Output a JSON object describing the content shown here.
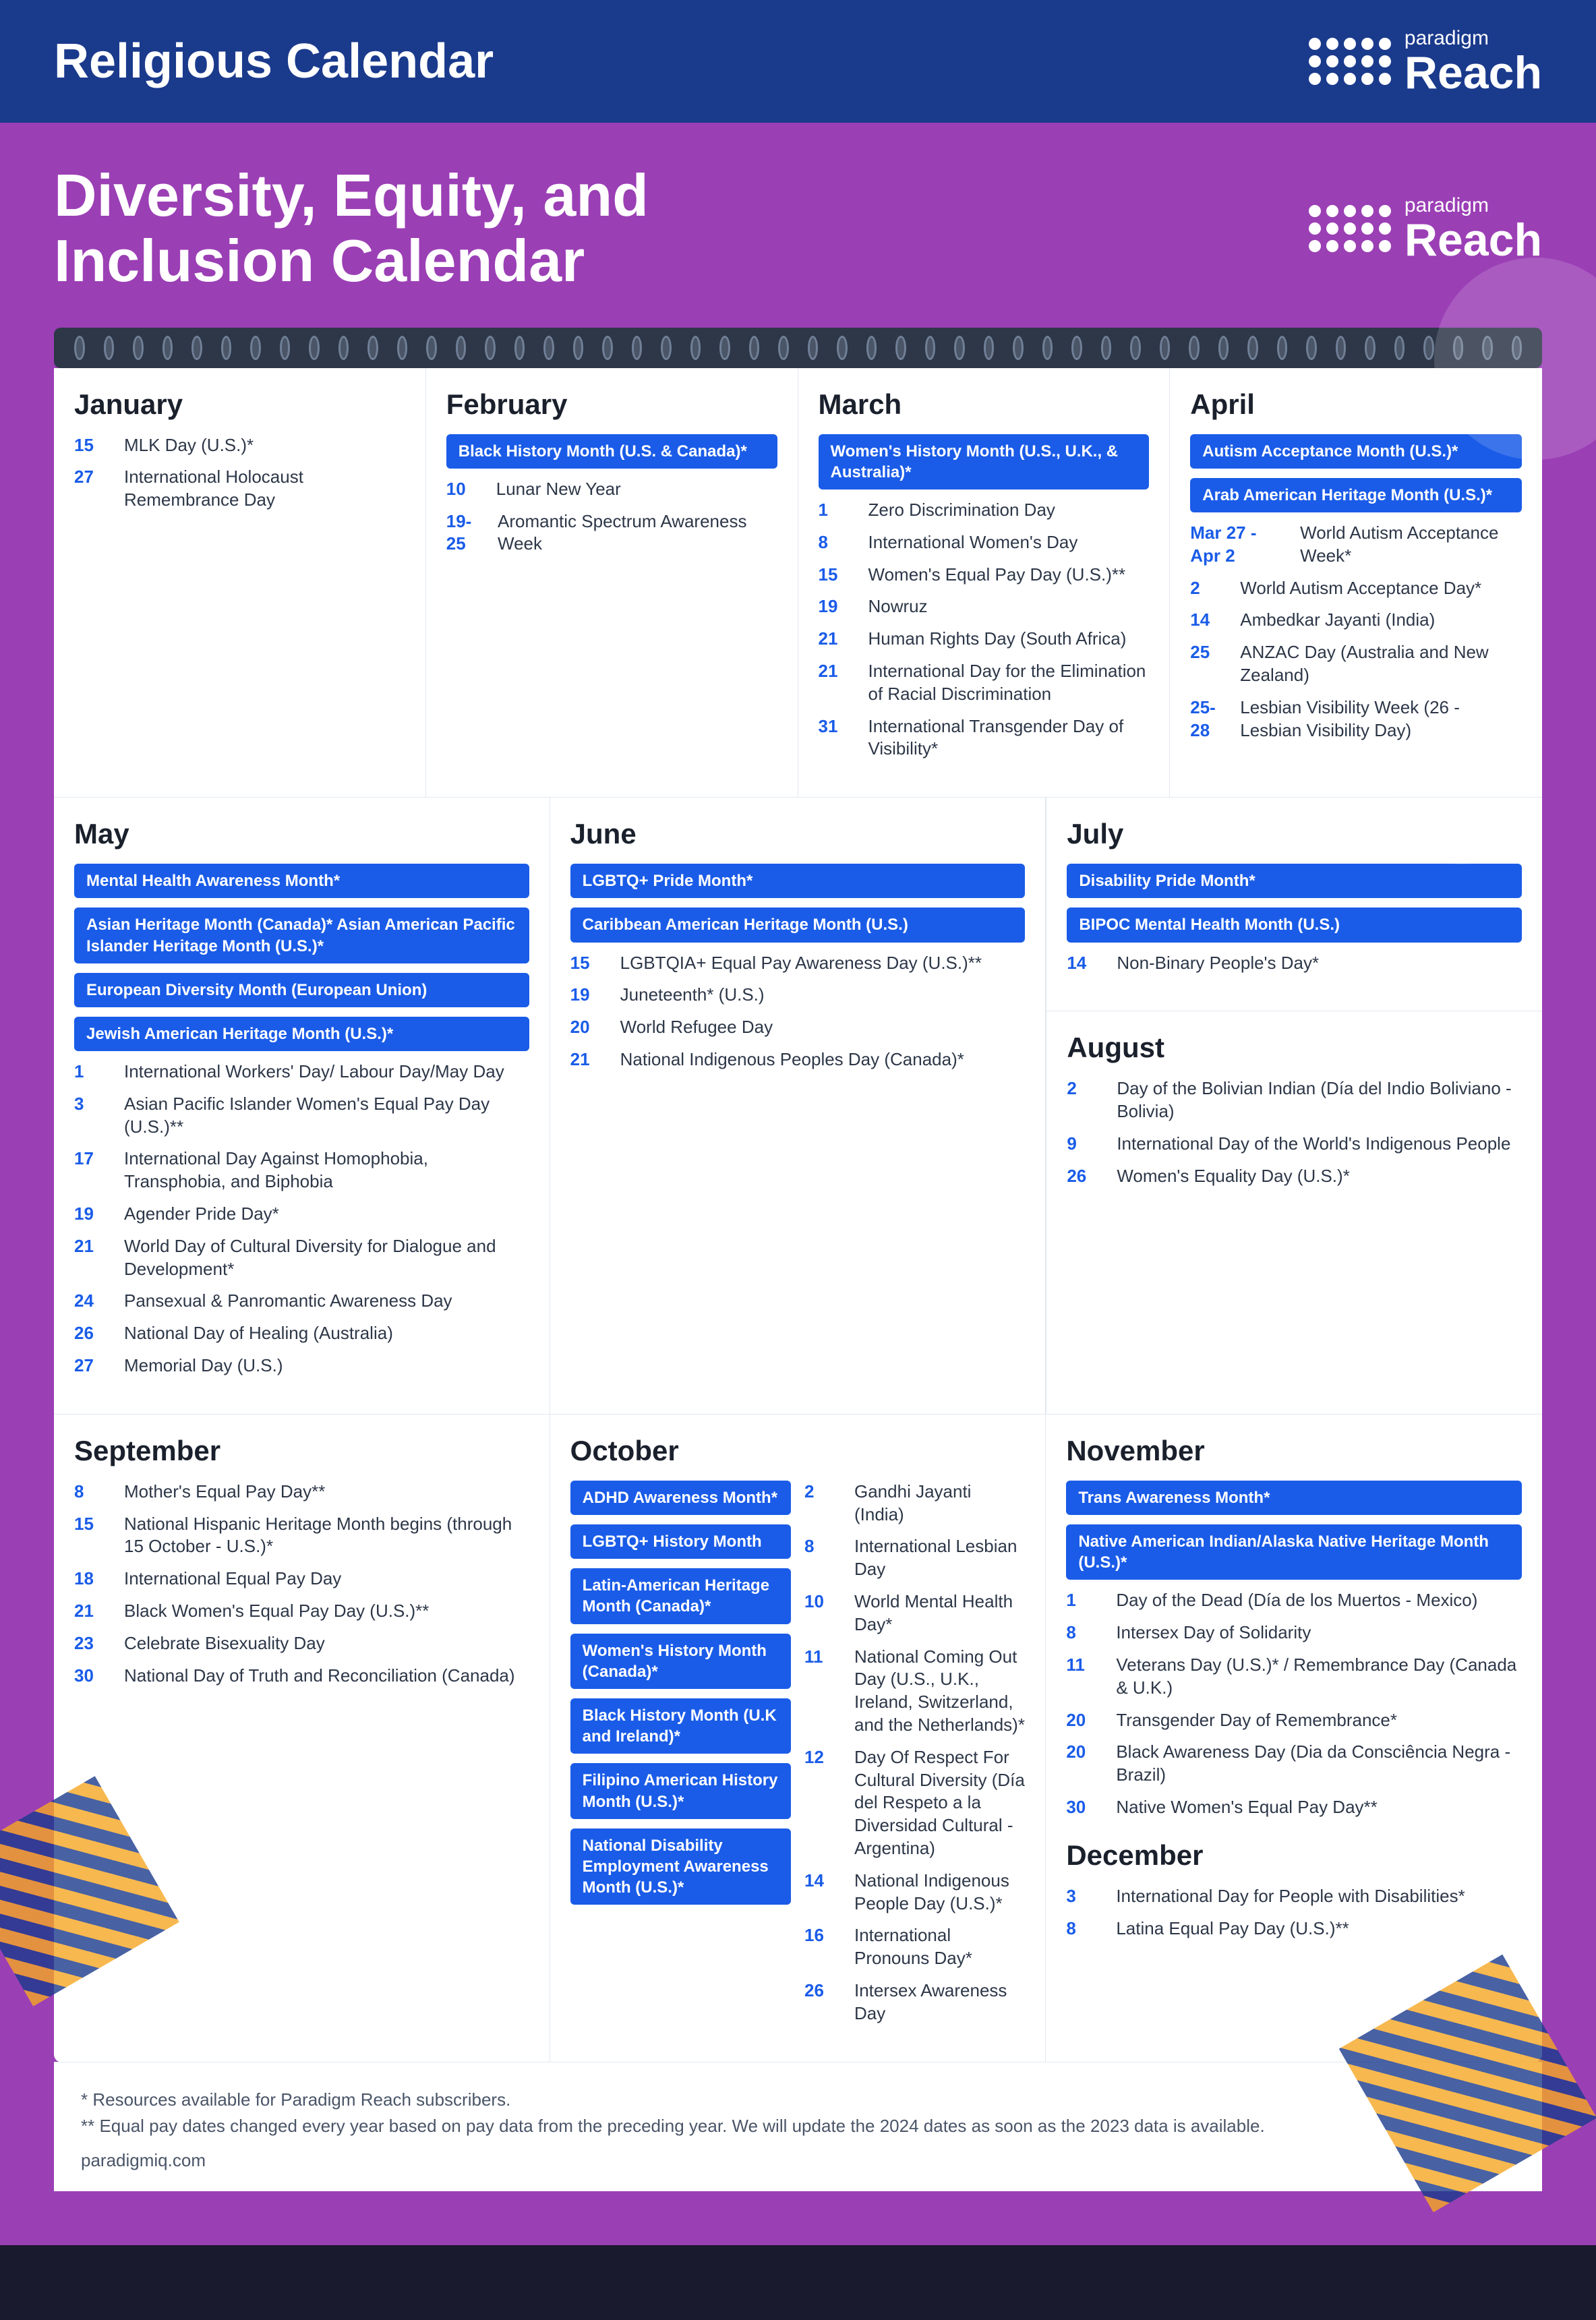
{
  "header": {
    "title": "Religious Calendar",
    "logo_paradigm": "paradigm",
    "logo_reach": "Reach"
  },
  "dei": {
    "title": "Diversity, Equity, and Inclusion Calendar",
    "logo_paradigm": "paradigm",
    "logo_reach": "Reach"
  },
  "months": {
    "january": {
      "name": "January",
      "badges": [],
      "events": [
        {
          "date": "15",
          "text": "MLK Day (U.S.)*"
        },
        {
          "date": "27",
          "text": "International Holocaust Remembrance Day"
        }
      ]
    },
    "february": {
      "name": "February",
      "badges": [
        {
          "text": "Black History Month (U.S. & Canada)*"
        }
      ],
      "events": [
        {
          "date": "10",
          "text": "Lunar New Year"
        },
        {
          "date": "19-25",
          "text": "Aromantic Spectrum Awareness Week"
        }
      ]
    },
    "march": {
      "name": "March",
      "badges": [
        {
          "text": "Women's History Month (U.S., U.K., & Australia)*"
        }
      ],
      "events": [
        {
          "date": "1",
          "text": "Zero Discrimination Day"
        },
        {
          "date": "8",
          "text": "International Women's Day"
        },
        {
          "date": "15",
          "text": "Women's Equal Pay Day (U.S.)**"
        },
        {
          "date": "19",
          "text": "Nowruz"
        },
        {
          "date": "21",
          "text": "Human Rights Day (South Africa)"
        },
        {
          "date": "21",
          "text": "International Day for the Elimination of Racial Discrimination"
        },
        {
          "date": "31",
          "text": "International Transgender Day of Visibility*"
        }
      ]
    },
    "april": {
      "name": "April",
      "badges": [
        {
          "text": "Autism Acceptance Month (U.S.)*"
        },
        {
          "text": "Arab American Heritage Month (U.S.)*"
        }
      ],
      "events": [
        {
          "date": "Mar 27 - Apr 2",
          "text": "World Autism Acceptance Week*"
        },
        {
          "date": "2",
          "text": "World Autism Acceptance Day*"
        },
        {
          "date": "14",
          "text": "Ambedkar Jayanti (India)"
        },
        {
          "date": "25",
          "text": "ANZAC Day (Australia and New Zealand)"
        },
        {
          "date": "25-28",
          "text": "Lesbian Visibility Week (26 - Lesbian Visibility Day)"
        }
      ]
    },
    "may": {
      "name": "May",
      "badges": [
        {
          "text": "Mental Health Awareness Month*"
        },
        {
          "text": "Asian Heritage Month (Canada)* Asian American Pacific Islander Heritage Month (U.S.)*"
        },
        {
          "text": "European Diversity Month (European Union)"
        },
        {
          "text": "Jewish American Heritage Month (U.S.)*"
        }
      ],
      "events": [
        {
          "date": "1",
          "text": "International Workers' Day/ Labour Day/May Day"
        },
        {
          "date": "3",
          "text": "Asian Pacific Islander Women's Equal Pay Day (U.S.)**"
        },
        {
          "date": "17",
          "text": "International Day Against Homophobia, Transphobia, and Biphobia"
        },
        {
          "date": "19",
          "text": "Agender Pride Day*"
        },
        {
          "date": "21",
          "text": "World Day of Cultural Diversity for Dialogue and Development*"
        },
        {
          "date": "24",
          "text": "Pansexual & Panromantic Awareness Day"
        },
        {
          "date": "26",
          "text": "National Day of Healing (Australia)"
        },
        {
          "date": "27",
          "text": "Memorial Day (U.S.)"
        }
      ]
    },
    "june": {
      "name": "June",
      "badges": [
        {
          "text": "LGBTQ+ Pride Month*"
        },
        {
          "text": "Caribbean American Heritage Month (U.S.)"
        }
      ],
      "events": [
        {
          "date": "15",
          "text": "LGBTQIA+ Equal Pay Awareness Day (U.S.)**"
        },
        {
          "date": "19",
          "text": "Juneteenth* (U.S.)"
        },
        {
          "date": "20",
          "text": "World Refugee Day"
        },
        {
          "date": "21",
          "text": "National Indigenous Peoples Day (Canada)*"
        }
      ]
    },
    "july": {
      "name": "July",
      "badges": [
        {
          "text": "Disability Pride Month*"
        },
        {
          "text": "BIPOC Mental Health Month (U.S.)"
        }
      ],
      "events": [
        {
          "date": "14",
          "text": "Non-Binary People's Day*"
        }
      ]
    },
    "august": {
      "name": "August",
      "badges": [],
      "events": [
        {
          "date": "2",
          "text": "Day of the Bolivian Indian (Día del Indio Boliviano - Bolivia)"
        },
        {
          "date": "9",
          "text": "International Day of the World's Indigenous People"
        },
        {
          "date": "26",
          "text": "Women's Equality Day (U.S.)*"
        }
      ]
    },
    "september": {
      "name": "September",
      "badges": [],
      "events": [
        {
          "date": "8",
          "text": "Mother's Equal Pay Day**"
        },
        {
          "date": "15",
          "text": "National Hispanic Heritage Month begins (through 15 October - U.S.)*"
        },
        {
          "date": "18",
          "text": "International Equal Pay Day"
        },
        {
          "date": "21",
          "text": "Black Women's Equal Pay Day (U.S.)**"
        },
        {
          "date": "23",
          "text": "Celebrate Bisexuality Day"
        },
        {
          "date": "30",
          "text": "National Day of Truth and Reconciliation (Canada)"
        }
      ]
    },
    "october": {
      "name": "October",
      "badges": [
        {
          "text": "ADHD Awareness Month*"
        },
        {
          "text": "LGBTQ+ History Month"
        },
        {
          "text": "Latin-American Heritage Month (Canada)*"
        },
        {
          "text": "Women's History Month (Canada)*"
        },
        {
          "text": "Black History Month (U.K and Ireland)*"
        },
        {
          "text": "Filipino American History Month (U.S.)*"
        },
        {
          "text": "National Disability Employment Awareness Month (U.S.)*"
        }
      ],
      "events": [
        {
          "date": "2",
          "text": "Gandhi Jayanti (India)"
        },
        {
          "date": "8",
          "text": "International Lesbian Day"
        },
        {
          "date": "10",
          "text": "World Mental Health Day*"
        },
        {
          "date": "11",
          "text": "National Coming Out Day (U.S., U.K., Ireland, Switzerland, and the Netherlands)*"
        },
        {
          "date": "12",
          "text": "Day Of Respect For Cultural Diversity (Día del Respeto a la Diversidad Cultural - Argentina)"
        },
        {
          "date": "14",
          "text": "National Indigenous People Day (U.S.)*"
        },
        {
          "date": "16",
          "text": "International Pronouns Day*"
        },
        {
          "date": "26",
          "text": "Intersex Awareness Day"
        }
      ]
    },
    "november": {
      "name": "November",
      "badges": [
        {
          "text": "Trans Awareness Month*"
        },
        {
          "text": "Native American Indian/Alaska Native Heritage Month (U.S.)*"
        }
      ],
      "events": [
        {
          "date": "1",
          "text": "Day of the Dead (Día de los Muertos - Mexico)"
        },
        {
          "date": "8",
          "text": "Intersex Day of Solidarity"
        },
        {
          "date": "11",
          "text": "Veterans Day (U.S.)* / Remembrance Day (Canada & U.K.)"
        },
        {
          "date": "20",
          "text": "Transgender Day of Remembrance*"
        },
        {
          "date": "20",
          "text": "Black Awareness Day (Dia da Consciência Negra - Brazil)"
        },
        {
          "date": "30",
          "text": "Native Women's Equal Pay Day**"
        }
      ]
    },
    "december": {
      "name": "December",
      "badges": [],
      "events": [
        {
          "date": "3",
          "text": "International Day for People with Disabilities*"
        },
        {
          "date": "8",
          "text": "Latina Equal Pay Day (U.S.)**"
        }
      ]
    }
  },
  "footer": {
    "note1": "*  Resources available for Paradigm Reach subscribers.",
    "note2": "** Equal pay dates changed every year based on pay data from the preceding year. We will update the 2024 dates as soon as the 2023 data is available.",
    "website": "paradigmiq.com"
  }
}
